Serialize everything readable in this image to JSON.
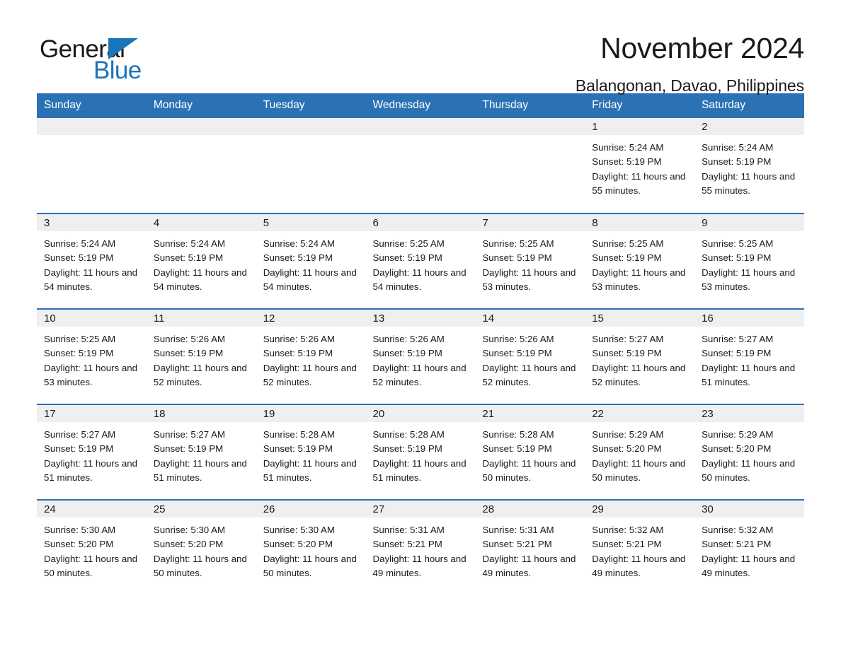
{
  "brand": {
    "name_part1": "General",
    "name_part2": "Blue",
    "triangle_icon": "triangle-icon",
    "accent_color": "#1b75bb"
  },
  "header": {
    "month_title": "November 2024",
    "location": "Balangonan, Davao, Philippines"
  },
  "colors": {
    "header_blue": "#2b72b5",
    "daynum_band": "#efefef",
    "row_divider": "#2b72b5",
    "text": "#1a1a1a",
    "header_text": "#ffffff"
  },
  "weekday_headers": [
    "Sunday",
    "Monday",
    "Tuesday",
    "Wednesday",
    "Thursday",
    "Friday",
    "Saturday"
  ],
  "weeks": [
    [
      {
        "day": "",
        "info": "",
        "empty": true
      },
      {
        "day": "",
        "info": "",
        "empty": true
      },
      {
        "day": "",
        "info": "",
        "empty": true
      },
      {
        "day": "",
        "info": "",
        "empty": true
      },
      {
        "day": "",
        "info": "",
        "empty": true
      },
      {
        "day": "1",
        "info": "Sunrise: 5:24 AM\nSunset: 5:19 PM\nDaylight: 11 hours and 55 minutes.",
        "empty": false
      },
      {
        "day": "2",
        "info": "Sunrise: 5:24 AM\nSunset: 5:19 PM\nDaylight: 11 hours and 55 minutes.",
        "empty": false
      }
    ],
    [
      {
        "day": "3",
        "info": "Sunrise: 5:24 AM\nSunset: 5:19 PM\nDaylight: 11 hours and 54 minutes.",
        "empty": false
      },
      {
        "day": "4",
        "info": "Sunrise: 5:24 AM\nSunset: 5:19 PM\nDaylight: 11 hours and 54 minutes.",
        "empty": false
      },
      {
        "day": "5",
        "info": "Sunrise: 5:24 AM\nSunset: 5:19 PM\nDaylight: 11 hours and 54 minutes.",
        "empty": false
      },
      {
        "day": "6",
        "info": "Sunrise: 5:25 AM\nSunset: 5:19 PM\nDaylight: 11 hours and 54 minutes.",
        "empty": false
      },
      {
        "day": "7",
        "info": "Sunrise: 5:25 AM\nSunset: 5:19 PM\nDaylight: 11 hours and 53 minutes.",
        "empty": false
      },
      {
        "day": "8",
        "info": "Sunrise: 5:25 AM\nSunset: 5:19 PM\nDaylight: 11 hours and 53 minutes.",
        "empty": false
      },
      {
        "day": "9",
        "info": "Sunrise: 5:25 AM\nSunset: 5:19 PM\nDaylight: 11 hours and 53 minutes.",
        "empty": false
      }
    ],
    [
      {
        "day": "10",
        "info": "Sunrise: 5:25 AM\nSunset: 5:19 PM\nDaylight: 11 hours and 53 minutes.",
        "empty": false
      },
      {
        "day": "11",
        "info": "Sunrise: 5:26 AM\nSunset: 5:19 PM\nDaylight: 11 hours and 52 minutes.",
        "empty": false
      },
      {
        "day": "12",
        "info": "Sunrise: 5:26 AM\nSunset: 5:19 PM\nDaylight: 11 hours and 52 minutes.",
        "empty": false
      },
      {
        "day": "13",
        "info": "Sunrise: 5:26 AM\nSunset: 5:19 PM\nDaylight: 11 hours and 52 minutes.",
        "empty": false
      },
      {
        "day": "14",
        "info": "Sunrise: 5:26 AM\nSunset: 5:19 PM\nDaylight: 11 hours and 52 minutes.",
        "empty": false
      },
      {
        "day": "15",
        "info": "Sunrise: 5:27 AM\nSunset: 5:19 PM\nDaylight: 11 hours and 52 minutes.",
        "empty": false
      },
      {
        "day": "16",
        "info": "Sunrise: 5:27 AM\nSunset: 5:19 PM\nDaylight: 11 hours and 51 minutes.",
        "empty": false
      }
    ],
    [
      {
        "day": "17",
        "info": "Sunrise: 5:27 AM\nSunset: 5:19 PM\nDaylight: 11 hours and 51 minutes.",
        "empty": false
      },
      {
        "day": "18",
        "info": "Sunrise: 5:27 AM\nSunset: 5:19 PM\nDaylight: 11 hours and 51 minutes.",
        "empty": false
      },
      {
        "day": "19",
        "info": "Sunrise: 5:28 AM\nSunset: 5:19 PM\nDaylight: 11 hours and 51 minutes.",
        "empty": false
      },
      {
        "day": "20",
        "info": "Sunrise: 5:28 AM\nSunset: 5:19 PM\nDaylight: 11 hours and 51 minutes.",
        "empty": false
      },
      {
        "day": "21",
        "info": "Sunrise: 5:28 AM\nSunset: 5:19 PM\nDaylight: 11 hours and 50 minutes.",
        "empty": false
      },
      {
        "day": "22",
        "info": "Sunrise: 5:29 AM\nSunset: 5:20 PM\nDaylight: 11 hours and 50 minutes.",
        "empty": false
      },
      {
        "day": "23",
        "info": "Sunrise: 5:29 AM\nSunset: 5:20 PM\nDaylight: 11 hours and 50 minutes.",
        "empty": false
      }
    ],
    [
      {
        "day": "24",
        "info": "Sunrise: 5:30 AM\nSunset: 5:20 PM\nDaylight: 11 hours and 50 minutes.",
        "empty": false
      },
      {
        "day": "25",
        "info": "Sunrise: 5:30 AM\nSunset: 5:20 PM\nDaylight: 11 hours and 50 minutes.",
        "empty": false
      },
      {
        "day": "26",
        "info": "Sunrise: 5:30 AM\nSunset: 5:20 PM\nDaylight: 11 hours and 50 minutes.",
        "empty": false
      },
      {
        "day": "27",
        "info": "Sunrise: 5:31 AM\nSunset: 5:21 PM\nDaylight: 11 hours and 49 minutes.",
        "empty": false
      },
      {
        "day": "28",
        "info": "Sunrise: 5:31 AM\nSunset: 5:21 PM\nDaylight: 11 hours and 49 minutes.",
        "empty": false
      },
      {
        "day": "29",
        "info": "Sunrise: 5:32 AM\nSunset: 5:21 PM\nDaylight: 11 hours and 49 minutes.",
        "empty": false
      },
      {
        "day": "30",
        "info": "Sunrise: 5:32 AM\nSunset: 5:21 PM\nDaylight: 11 hours and 49 minutes.",
        "empty": false
      }
    ]
  ]
}
